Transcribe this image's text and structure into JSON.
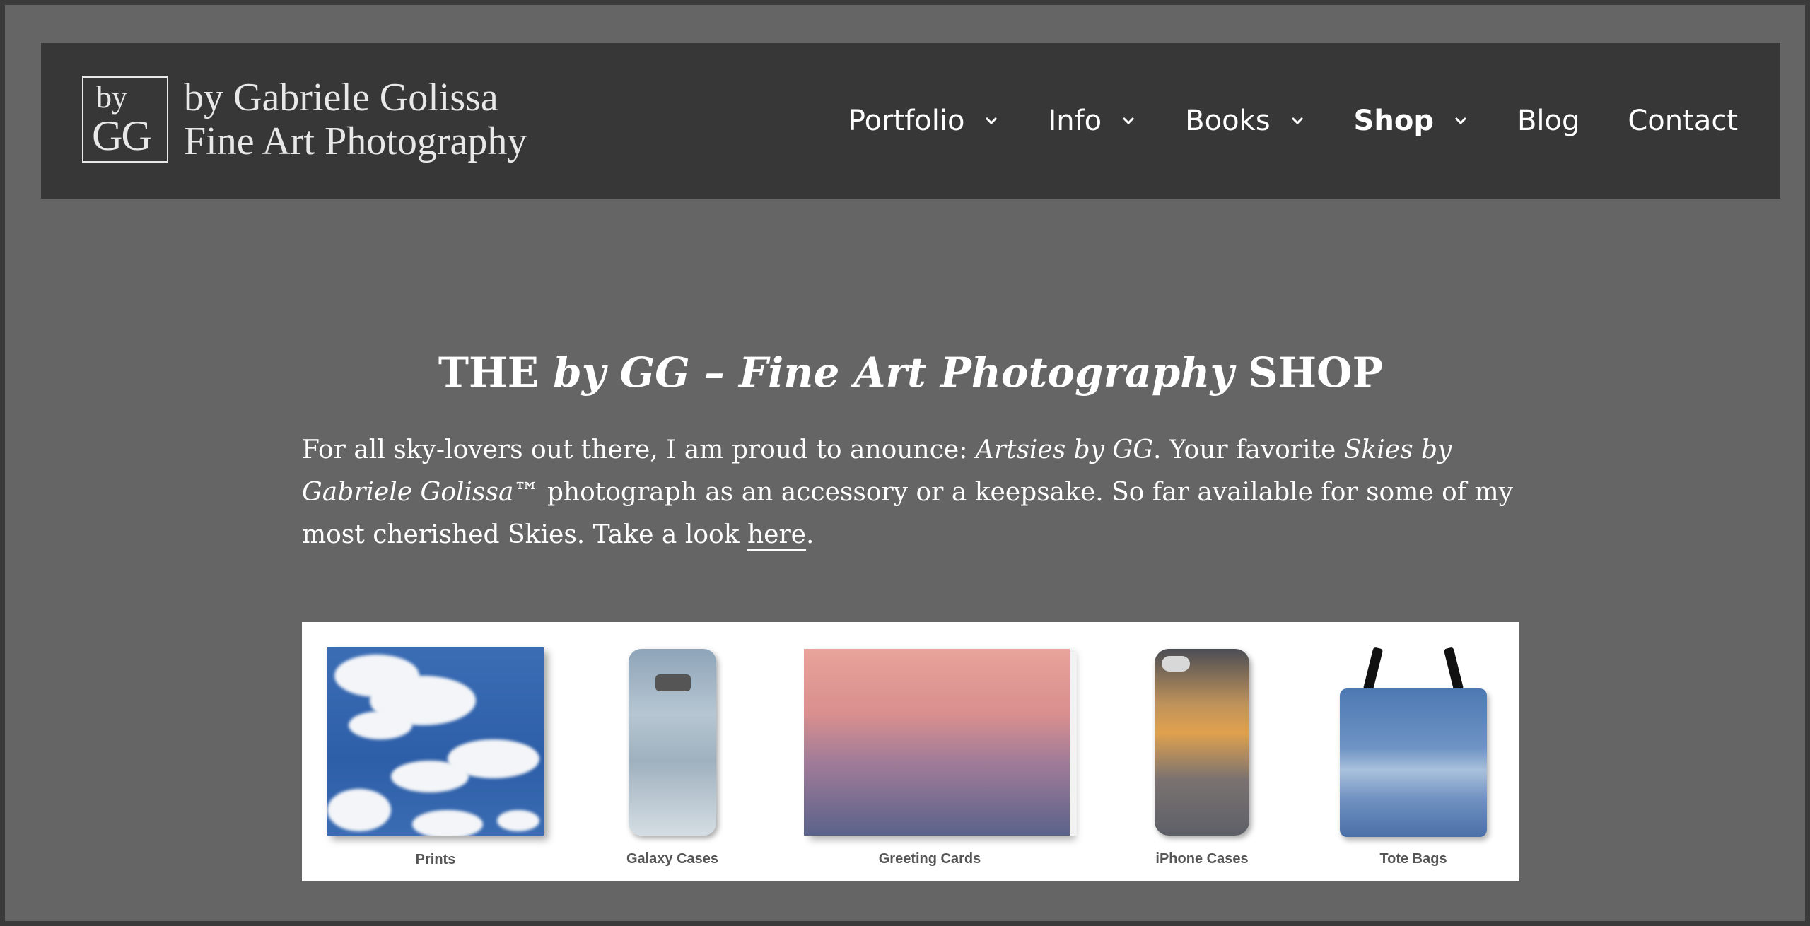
{
  "header": {
    "logo": {
      "by": "by",
      "gg": "GG",
      "line1": "by Gabriele Golissa",
      "line2": "Fine Art Photography"
    },
    "nav": [
      {
        "label": "Portfolio",
        "has_dropdown": true,
        "active": false
      },
      {
        "label": "Info",
        "has_dropdown": true,
        "active": false
      },
      {
        "label": "Books",
        "has_dropdown": true,
        "active": false
      },
      {
        "label": "Shop",
        "has_dropdown": true,
        "active": true
      },
      {
        "label": "Blog",
        "has_dropdown": false,
        "active": false
      },
      {
        "label": "Contact",
        "has_dropdown": false,
        "active": false
      }
    ]
  },
  "main": {
    "title": {
      "prefix": "THE ",
      "italic": "by GG – Fine Art Photography",
      "suffix": " SHOP"
    },
    "intro": {
      "part1": "For all sky-lovers out there, I am proud to anounce: ",
      "italic1": "Artsies by GG",
      "part2": ". Your favorite ",
      "italic2": "Skies by Gabriele Golissa™",
      "part3": " photograph as an accessory or a keepsake. So far available for some of my most cherished Skies. Take a look ",
      "link": "here",
      "part4": "."
    },
    "products": [
      {
        "label": "Prints"
      },
      {
        "label": "Galaxy Cases"
      },
      {
        "label": "Greeting Cards"
      },
      {
        "label": "iPhone Cases"
      },
      {
        "label": "Tote Bags"
      }
    ]
  },
  "colors": {
    "page_background": "#656565",
    "header_background": "#373737",
    "text": "#ffffff"
  }
}
